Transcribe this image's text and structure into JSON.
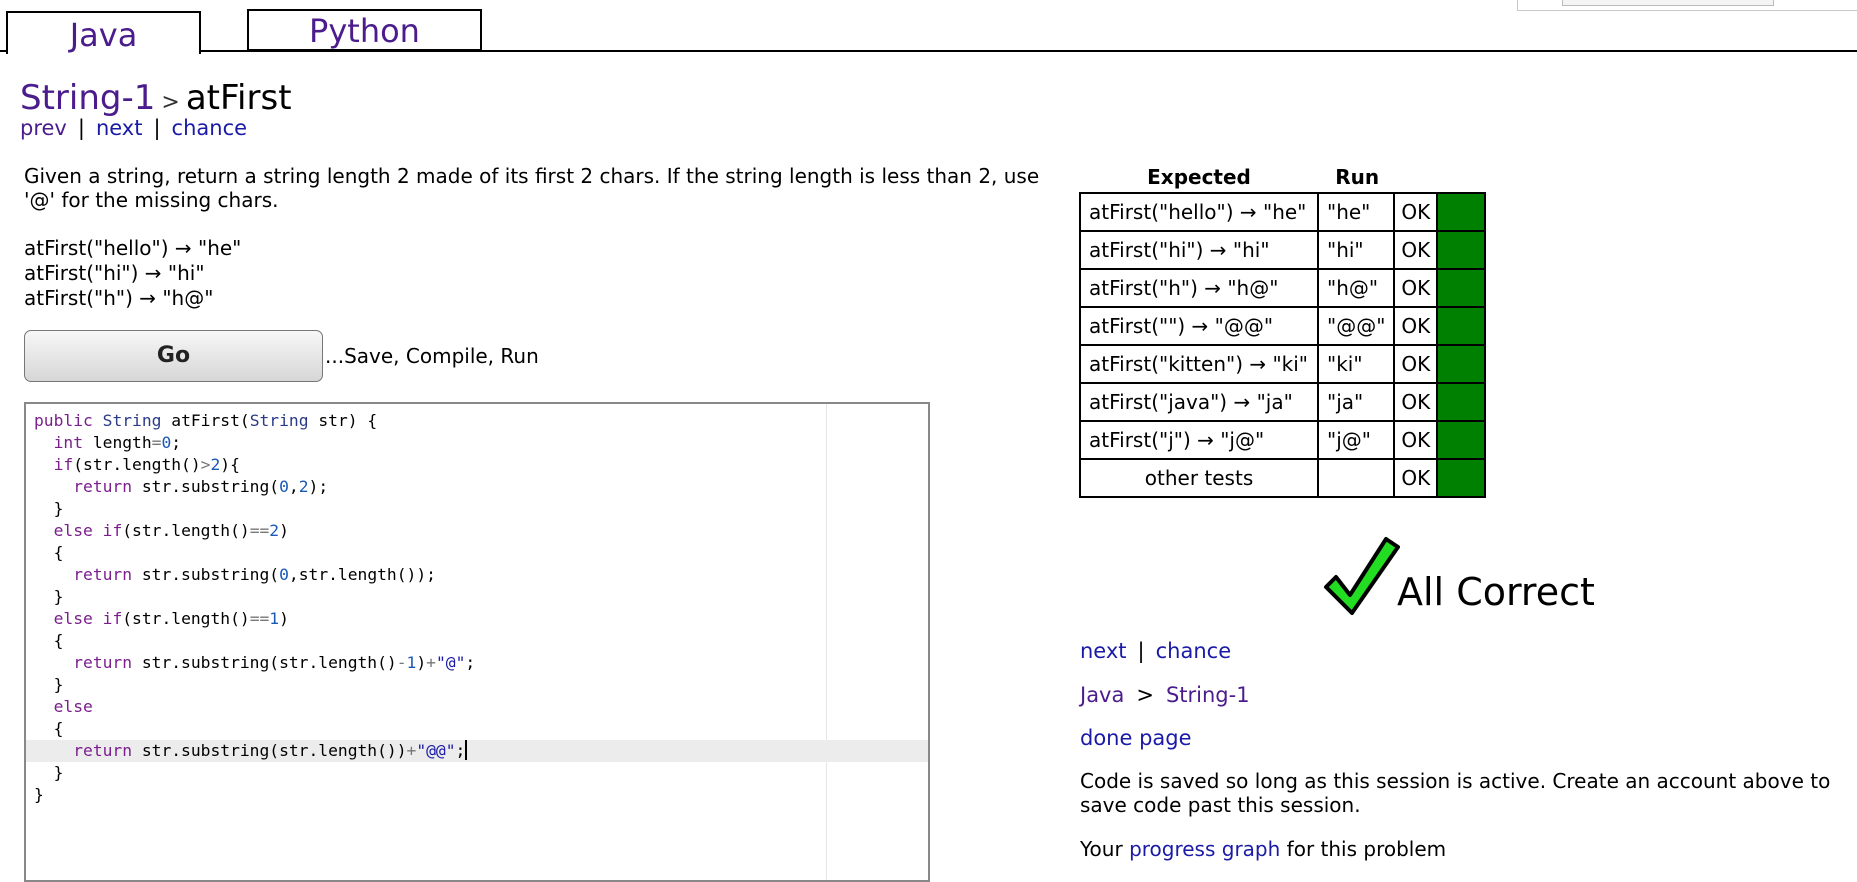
{
  "tabs": [
    {
      "label": "Java"
    },
    {
      "label": "Python"
    }
  ],
  "breadcrumb": {
    "section": "String-1",
    "separator": ">",
    "problem": "atFirst"
  },
  "nav": {
    "prev": "prev",
    "next": "next",
    "chance": "chance",
    "pipe": "|"
  },
  "description": "Given a string, return a string length 2 made of its first 2 chars. If the string length is less than 2, use '@' for the missing chars.",
  "examples": [
    "atFirst(\"hello\") → \"he\"",
    "atFirst(\"hi\") → \"hi\"",
    "atFirst(\"h\") → \"h@\""
  ],
  "go_button": "Go",
  "go_label": "...Save, Compile, Run",
  "code_lines": [
    "public String atFirst(String str) {",
    "  int length=0;",
    "  if(str.length()>2){",
    "    return str.substring(0,2);",
    "  }",
    "  else if(str.length()==2)",
    "  {",
    "    return str.substring(0,str.length());",
    "  }",
    "  else if(str.length()==1)",
    "  {",
    "    return str.substring(str.length()-1)+\"@\";",
    "  }",
    "  else",
    "  {",
    "    return str.substring(str.length())+\"@@\";",
    "  }",
    "}"
  ],
  "results": {
    "headers": {
      "expected": "Expected",
      "run": "Run"
    },
    "rows": [
      {
        "expected": "atFirst(\"hello\") → \"he\"",
        "run": "\"he\"",
        "status": "OK"
      },
      {
        "expected": "atFirst(\"hi\") → \"hi\"",
        "run": "\"hi\"",
        "status": "OK"
      },
      {
        "expected": "atFirst(\"h\") → \"h@\"",
        "run": "\"h@\"",
        "status": "OK"
      },
      {
        "expected": "atFirst(\"\") → \"@@\"",
        "run": "\"@@\"",
        "status": "OK"
      },
      {
        "expected": "atFirst(\"kitten\") → \"ki\"",
        "run": "\"ki\"",
        "status": "OK"
      },
      {
        "expected": "atFirst(\"java\") → \"ja\"",
        "run": "\"ja\"",
        "status": "OK"
      },
      {
        "expected": "atFirst(\"j\") → \"j@\"",
        "run": "\"j@\"",
        "status": "OK"
      },
      {
        "expected": "other tests",
        "run": "",
        "status": "OK"
      }
    ],
    "pass_color": "#008000"
  },
  "result_message": "All Correct",
  "result_icon": "checkmark-icon",
  "right_nav": {
    "next": "next",
    "chance": "chance",
    "pipe": "|"
  },
  "right_breadcrumb": {
    "lang": "Java",
    "gt": ">",
    "section": "String-1"
  },
  "done_page": "done page",
  "save_note": "Code is saved so long as this session is active. Create an account above to save code past this session.",
  "progress": {
    "prefix": "Your ",
    "link": "progress graph",
    "suffix": " for this problem"
  },
  "colors": {
    "accent": "#4b1c8c",
    "link": "#1a1aa6",
    "ok_green": "#008000",
    "check_green": "#22dd22"
  }
}
